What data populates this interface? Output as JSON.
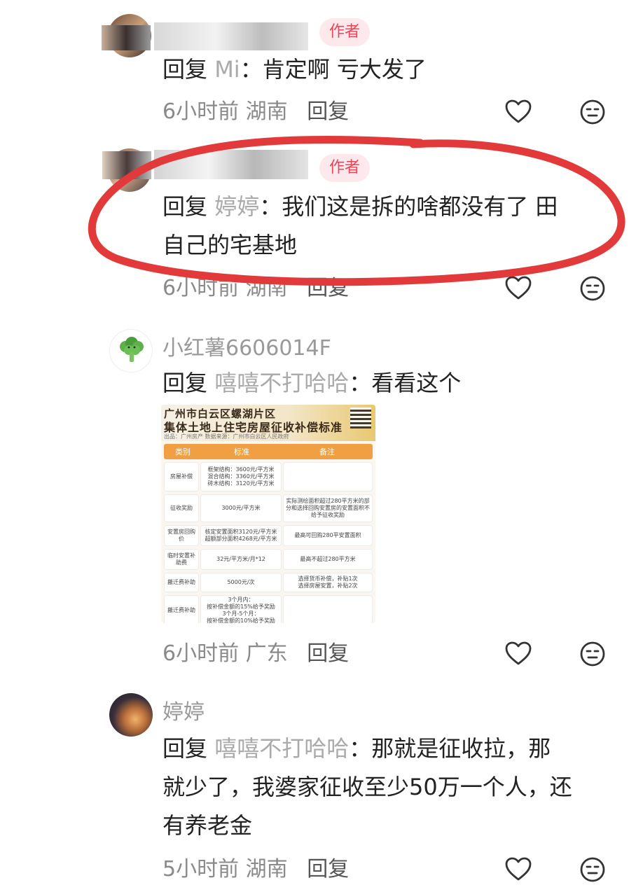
{
  "colors": {
    "author_badge_bg": "#fde8ec",
    "author_badge_text": "#e8445a",
    "annotation_circle": "#e23a3a"
  },
  "comments": [
    {
      "username_hidden": true,
      "badge": "作者",
      "reply_label": "回复",
      "reply_target": "Mi",
      "text": "肯定啊 亏大发了",
      "time": "6小时前",
      "location": "湖南",
      "reply_link": "回复",
      "icons": [
        "heart-icon",
        "neutral-face-icon"
      ]
    },
    {
      "username_hidden": true,
      "badge": "作者",
      "reply_label": "回复",
      "reply_target": "婷婷",
      "text_line1": "我们这是拆的啥都没有了 田",
      "text_line2": "自己的宅基地",
      "time": "6小时前",
      "location": "湖南",
      "reply_link": "回复",
      "circled": true,
      "icons": [
        "heart-icon",
        "neutral-face-icon"
      ]
    },
    {
      "username": "小红薯6606014F",
      "avatar": "broccoli-icon",
      "reply_label": "回复",
      "reply_target": "嘻嘻不打哈哈",
      "text": "看看这个",
      "time": "6小时前",
      "location": "广东",
      "reply_link": "回复",
      "icons": [
        "heart-icon",
        "neutral-face-icon"
      ],
      "attachment": {
        "title_line1": "广州市白云区螺湖片区",
        "title_line2": "集体土地上住宅房屋征收补偿标准",
        "source": "出品：广州房产  数据来源：广州市白云区人民政府",
        "header": [
          "类别",
          "标准",
          "备注"
        ],
        "rows": [
          {
            "category": "房屋补偿",
            "standard": "框架结构：3600元/平方米\n混合结构：3360元/平方米\n砖木结构：3120元/平方米",
            "note": ""
          },
          {
            "category": "征收奖励",
            "standard": "3000元/平方米",
            "note": "实际测绘面积超过280平方米的部分和选择回购安置房的安置面积不给予征收奖励"
          },
          {
            "category": "安置房回购价",
            "standard": "核定安置面积3120元/平方米\n超额部分面积4268元/平方米",
            "note": "最高可回购280平安置面积"
          },
          {
            "category": "临时安置补助费",
            "standard": "32元/平方米/月*12",
            "note": "最高不超过280平方米"
          },
          {
            "category": "搬迁费补助",
            "standard": "5000元/次",
            "note": "选择货币补偿，补贴1次\n选择房屋安置，补贴2次"
          },
          {
            "category": "搬迁费补助",
            "standard": "3个月内：\n按补偿金额的15%给予奖励\n3个月-5个月：\n按补偿金额的10%给予奖励",
            "note": ""
          }
        ]
      }
    },
    {
      "username": "婷婷",
      "reply_label": "回复",
      "reply_target": "嘻嘻不打哈哈",
      "text_line1": "那就是征收拉，那",
      "text_line2": "就少了，我婆家征收至少50万一个人，还",
      "text_line3": "有养老金",
      "time": "5小时前",
      "location": "湖南",
      "reply_link": "回复",
      "icons": [
        "heart-icon",
        "neutral-face-icon"
      ]
    }
  ]
}
